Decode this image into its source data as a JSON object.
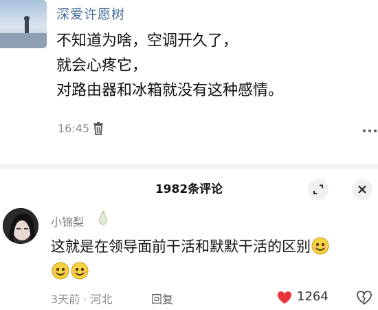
{
  "post": {
    "author": "深爱许愿树",
    "lines": [
      "不知道为啥，空调开久了，",
      "就会心疼它，",
      "对路由器和冰箱就没有这种感情。"
    ],
    "time": "16:45",
    "icons": {
      "delete": "trash-icon",
      "more": "more-icon"
    }
  },
  "comments_panel": {
    "count_label": "1982条评论",
    "icons": {
      "expand": "expand-icon",
      "close": "close-icon"
    }
  },
  "comment": {
    "author": "小锦梨",
    "badge_icon": "pear-icon",
    "text": "这就是在领导面前干活和默默干活的区别",
    "emojis": [
      "smile-emoji",
      "smile-emoji",
      "smile-emoji"
    ],
    "meta": "3天前 · 河北",
    "reply_label": "回复",
    "like_count": "1264",
    "colors": {
      "like": "#e8323c"
    }
  }
}
